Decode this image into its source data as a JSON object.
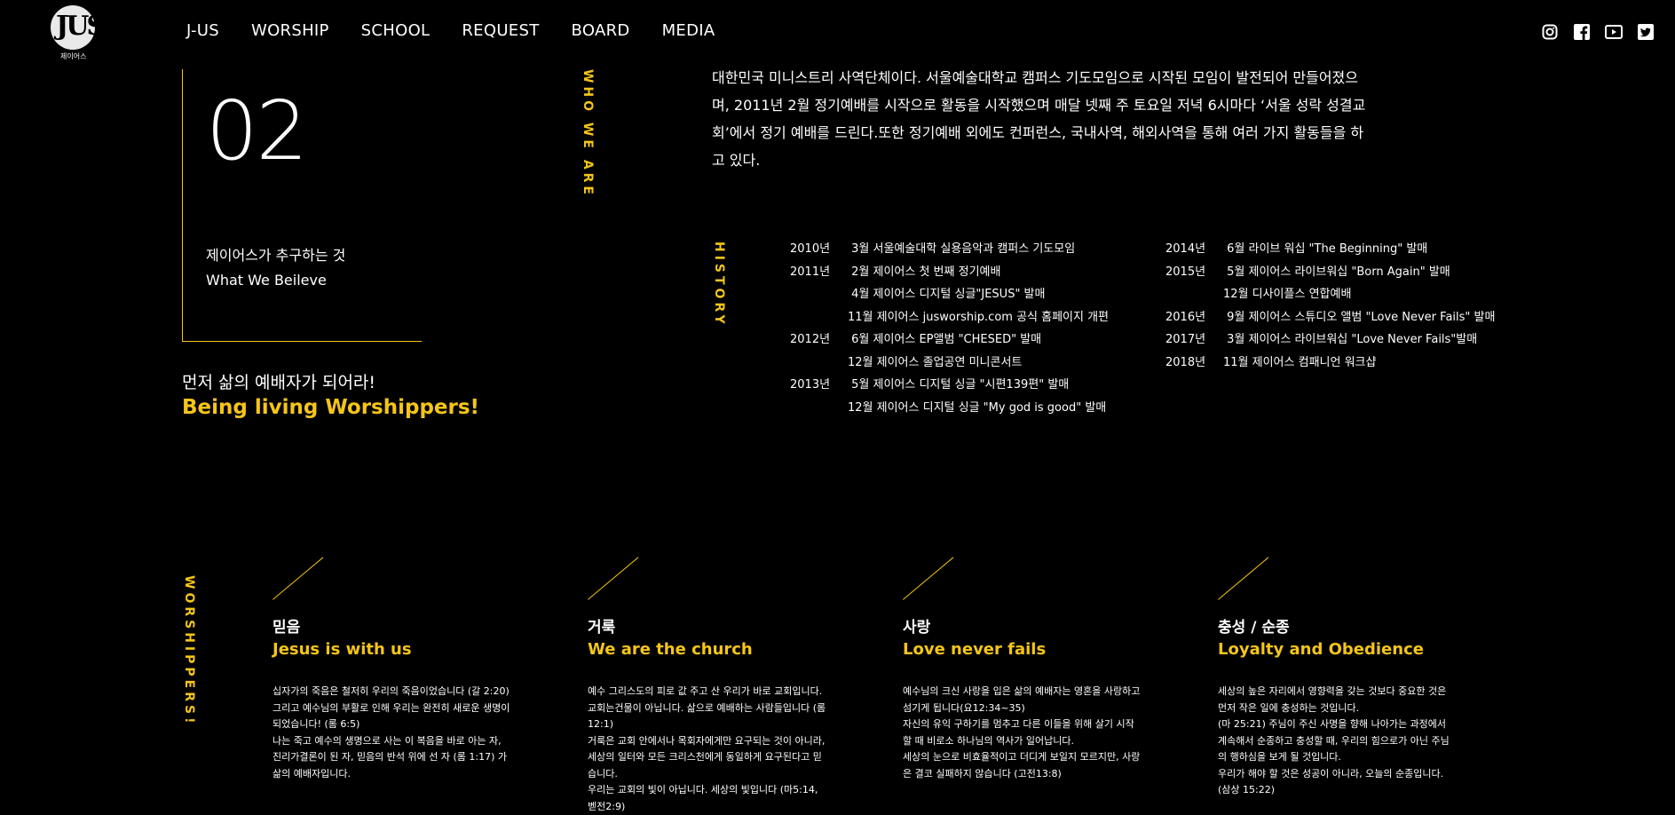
{
  "header": {
    "logo_text": "JUS",
    "logo_sub": "제이어스",
    "nav": [
      "J-US",
      "WORSHIP",
      "SCHOOL",
      "REQUEST",
      "BOARD",
      "MEDIA"
    ],
    "socials": [
      "instagram-icon",
      "facebook-icon",
      "youtube-icon",
      "twitter-icon"
    ]
  },
  "intro": {
    "number": "02",
    "pursue_ko": "제이어스가 추구하는 것",
    "pursue_en": "What We Beileve",
    "slogan_ko": "먼저 삶의 예배자가 되어라!",
    "slogan_en": "Being living Worshippers!"
  },
  "labels": {
    "who": "WHO WE ARE",
    "history": "HISTORY",
    "worshippers": "WORSHIPPERS!"
  },
  "about": "대한민국 미니스트리 사역단체이다. 서울예술대학교 캠퍼스 기도모임으로 시작된 모임이 발전되어 만들어졌으며, 2011년 2월 정기예배를 시작으로 활동을 시작했으며 매달 넷째 주 토요일 저녁 6시마다 ‘서울 성락 성결교회’에서 정기 예배를 드린다.또한 정기예배 외에도 컨퍼런스, 국내사역, 해외사역을 통해 여러 가지 활동들을 하고 있다.",
  "history_left": [
    {
      "year": "2010년",
      "event": " 3월 서울예술대학 실용음악과 캠퍼스 기도모임"
    },
    {
      "year": "2011년",
      "event": " 2월 제이어스 첫 번째 정기예배"
    },
    {
      "year": "",
      "event": " 4월 제이어스 디지털 싱글\"JESUS\" 발매"
    },
    {
      "year": "",
      "event": "11월 제이어스 jusworship.com 공식 홈페이지 개편"
    },
    {
      "year": "2012년",
      "event": " 6월 제이어스 EP앨범 \"CHESED\" 발매"
    },
    {
      "year": "",
      "event": "12월 제이어스 졸업공연 미니콘서트"
    },
    {
      "year": "2013년",
      "event": " 5월 제이어스 디지털 싱글 \"시편139편\" 발매"
    },
    {
      "year": "",
      "event": "12월 제이어스 디지털 싱글 \"My god is good\" 발매"
    }
  ],
  "history_right": [
    {
      "year": "2014년",
      "event": " 6월 라이브 워십 \"The Beginning\" 발매"
    },
    {
      "year": "2015년",
      "event": " 5월 제이어스 라이브워십 \"Born Again\" 발매"
    },
    {
      "year": "",
      "event": "12월 디사이플스 연합예배"
    },
    {
      "year": "2016년",
      "event": " 9월 제이어스 스튜디오 앨범 \"Love Never Fails\" 발매"
    },
    {
      "year": "2017년",
      "event": " 3월 제이어스 라이브워십 \"Love Never Fails\"발매"
    },
    {
      "year": "2018년",
      "event": "11월 제이어스 컴패니언 워크샵"
    }
  ],
  "values": [
    {
      "ko": "믿음",
      "en": "Jesus is with us",
      "body": "십자가의 죽음은 철저히 우리의 죽음이었습니다 (갈 2:20)\n그리고 예수님의 부활로 인해 우리는 완전히 새로운 생명이 되었습니다! (롬 6:5)\n나는 죽고 예수의 생명으로 사는 이 복음을 바로 아는 자, 진리가결론이 된 자, 믿음의 반석 위에 선 자 (롬 1:17) 가 삶의 예배자입니다."
    },
    {
      "ko": "거룩",
      "en": "We are the church",
      "body": "예수 그리스도의 피로 값 주고 산 우리가 바로 교회입니다.\n교회는건물이 아닙니다. 삶으로 예배하는 사람들입니다 (롬12:1)\n거룩은 교회 안에서나 목회자에게만 요구되는 것이 아니라, 세상의 일터와 모든 크리스천에게 동일하게 요구된다고 믿습니다.\n우리는 교회의 빛이 아닙니다. 세상의 빛입니다 (마5:14, 벧전2:9)"
    },
    {
      "ko": "사랑",
      "en": "Love never fails",
      "body": "예수님의 크신 사랑을 입은 삶의 예배자는 영혼을 사랑하고 섬기게 됩니다(요12:34~35)\n자신의 유익 구하기를 멈추고 다른 이들을 위해 살기 시작할 때 비로소 하나님의 역사가 일어납니다.\n세상의 눈으로 비효율적이고 더디게 보일지 모르지만, 사랑은 결코 실패하지 않습니다 (고전13:8)"
    },
    {
      "ko": "충성 / 순종",
      "en": "Loyalty and Obedience",
      "body": "세상의 높은 자리에서 영향력을 갖는 것보다 중요한 것은 먼저 작은 일에 충성하는 것입니다.\n(마 25:21) 주님이 주신 사명을 향해 나아가는 과정에서 계속해서 순종하고 충성할 때, 우리의 힘으로가 아닌 주님의 행하심을 보게 될 것입니다.\n우리가 해야 할 것은 성공이 아니라, 오늘의 순종입니다.\n(삼상 15:22)"
    }
  ]
}
